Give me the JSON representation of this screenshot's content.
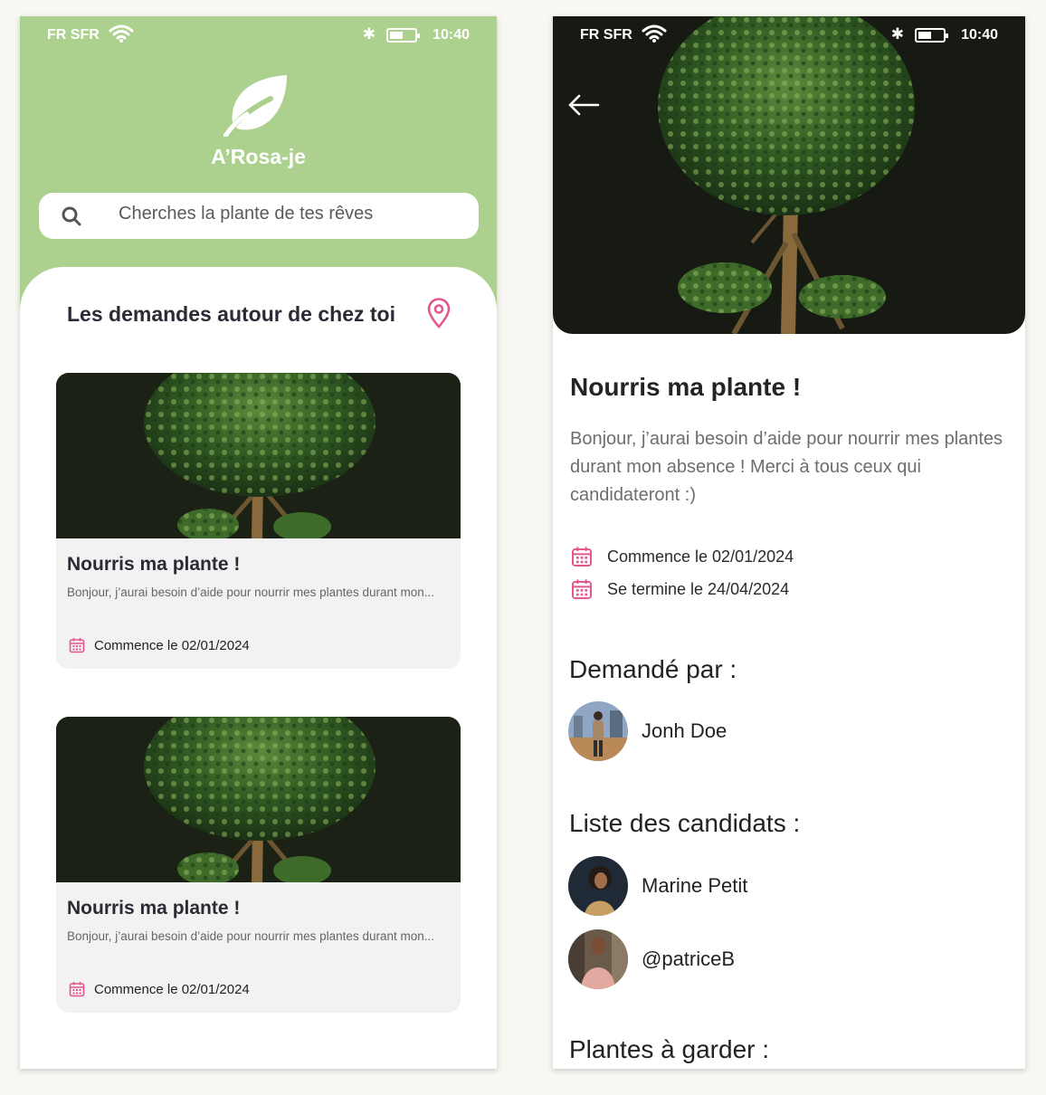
{
  "status_bar": {
    "carrier": "FR SFR",
    "time": "10:40"
  },
  "left_screen": {
    "app_name": "A’Rosa-je",
    "search_placeholder": "Cherches la plante de tes rêves",
    "section_title": "Les demandes autour de chez toi",
    "cards": [
      {
        "title": "Nourris ma plante !",
        "description": "Bonjour, j’aurai besoin d’aide pour nourrir mes plantes durant mon...",
        "date": "Commence le 02/01/2024"
      },
      {
        "title": "Nourris ma plante !",
        "description": "Bonjour, j’aurai besoin d’aide pour nourrir mes plantes durant mon...",
        "date": "Commence le 02/01/2024"
      }
    ]
  },
  "right_screen": {
    "title": "Nourris ma plante !",
    "description": "Bonjour, j’aurai besoin d’aide pour nourrir mes plantes durant mon absence ! Merci à tous ceux qui candidateront :)",
    "start_date": "Commence le 02/01/2024",
    "end_date": "Se termine le 24/04/2024",
    "requested_by_heading": "Demandé par :",
    "requester": {
      "name": "Jonh Doe"
    },
    "candidates_heading": "Liste des candidats :",
    "candidates": [
      {
        "name": "Marine Petit"
      },
      {
        "name": "@patriceB"
      }
    ],
    "plants_heading": "Plantes à garder :"
  },
  "colors": {
    "header_green": "#acd18f",
    "accent_pink": "#e0588d",
    "card_bg": "#f2f2f2"
  },
  "icons": [
    "leaf-icon",
    "search-icon",
    "location-pin-icon",
    "calendar-icon",
    "back-arrow-icon",
    "wifi-icon",
    "bluetooth-icon",
    "battery-icon"
  ]
}
